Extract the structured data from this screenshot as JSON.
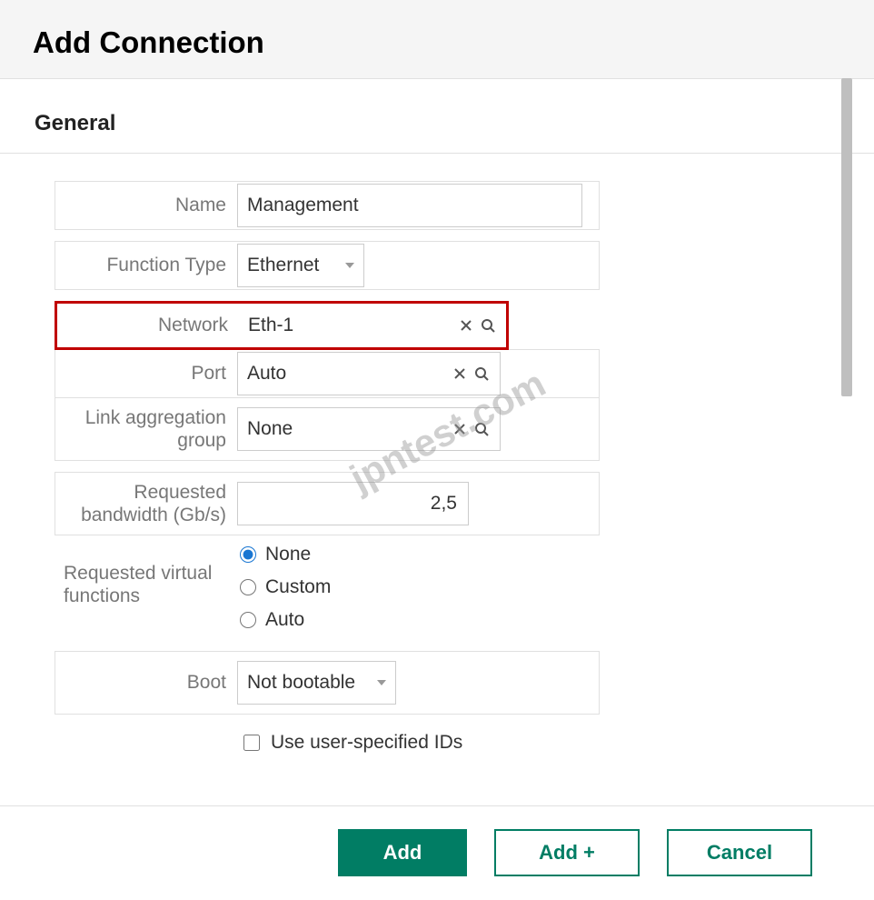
{
  "header": {
    "title": "Add Connection"
  },
  "section": {
    "title": "General"
  },
  "fields": {
    "name": {
      "label": "Name",
      "value": "Management"
    },
    "function_type": {
      "label": "Function Type",
      "value": "Ethernet"
    },
    "network": {
      "label": "Network",
      "value": "Eth-1"
    },
    "port": {
      "label": "Port",
      "value": "Auto"
    },
    "lag": {
      "label_line1": "Link aggregation",
      "label_line2": "group",
      "value": "None"
    },
    "bandwidth": {
      "label_line1": "Requested",
      "label_line2": "bandwidth (Gb/s)",
      "value": "2,5"
    },
    "vf": {
      "label_line1": "Requested virtual",
      "label_line2": "functions",
      "options": {
        "none": "None",
        "custom": "Custom",
        "auto": "Auto"
      },
      "selected": "none"
    },
    "boot": {
      "label": "Boot",
      "value": "Not bootable"
    },
    "use_ids": {
      "label": "Use user-specified IDs",
      "checked": false
    }
  },
  "footer": {
    "add": "Add",
    "add_plus": "Add +",
    "cancel": "Cancel"
  },
  "watermark": "jpntest.com"
}
